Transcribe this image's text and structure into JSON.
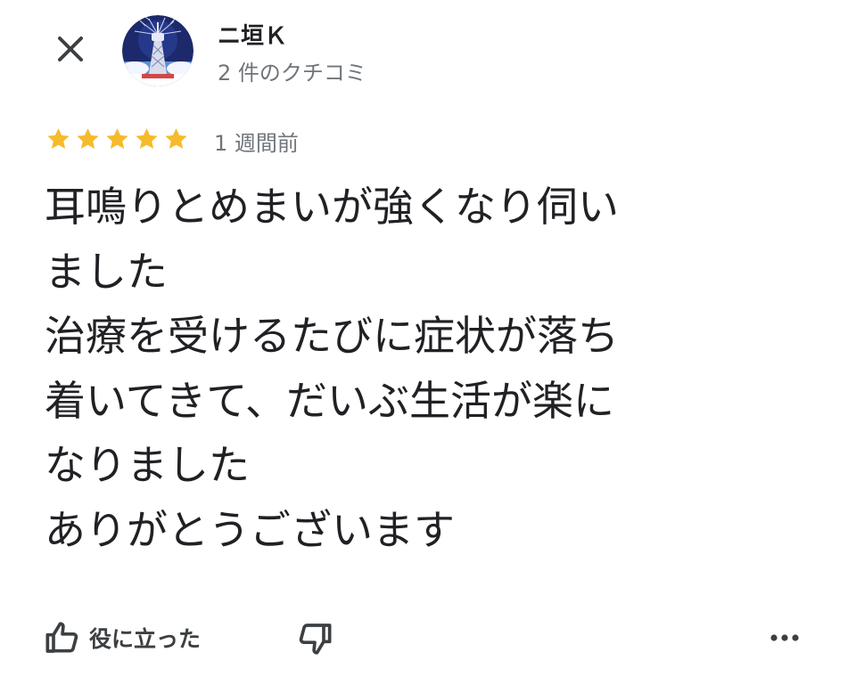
{
  "header": {
    "close_icon": "close-icon",
    "avatar_icon": "tower-avatar",
    "author_name": "ニ垣Ｋ",
    "review_count": "2 件のクチコミ"
  },
  "review": {
    "rating": 5,
    "max_rating": 5,
    "star_color": "#f6bb2a",
    "time_ago": "1 週間前",
    "lines": [
      "耳鳴りとめまいが強くなり伺い",
      "ました",
      "治療を受けるたびに症状が落ち",
      "着いてきて、だいぶ生活が楽に",
      "なりました",
      "ありがとうございます"
    ]
  },
  "actions": {
    "helpful_label": "役に立った",
    "helpful_icon": "thumbs-up-icon",
    "dislike_icon": "thumbs-down-icon",
    "more_icon": "more-horiz-icon"
  }
}
